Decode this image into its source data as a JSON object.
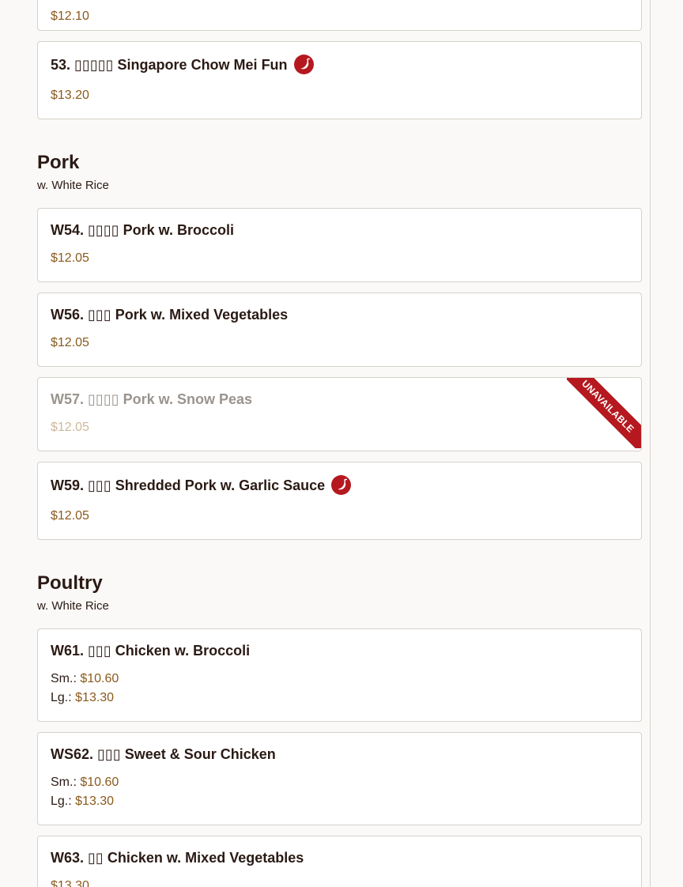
{
  "colors": {
    "price": "#8a5a1c",
    "spicy_badge": "#b5191f",
    "unavailable_ribbon": "#b5191f",
    "border": "#d6d1cb"
  },
  "top_card": {
    "price": "$12.10"
  },
  "card_53": {
    "title": "53. ▯▯▯▯▯ Singapore Chow Mei Fun",
    "spicy_icon": "chili-pepper-icon",
    "price": "$13.20"
  },
  "pork": {
    "title": "Pork",
    "subtitle": "w. White Rice",
    "items": [
      {
        "title": "W54. ▯▯▯▯ Pork w. Broccoli",
        "price": "$12.05"
      },
      {
        "title": "W56. ▯▯▯ Pork w. Mixed Vegetables",
        "price": "$12.05"
      },
      {
        "title": "W57. ▯▯▯▯ Pork w. Snow Peas",
        "price": "$12.05",
        "ribbon": "UNAVAILABLE"
      },
      {
        "title": "W59. ▯▯▯ Shredded Pork w. Garlic Sauce",
        "price": "$12.05",
        "spicy_icon": "chili-pepper-icon"
      }
    ]
  },
  "poultry": {
    "title": "Poultry",
    "subtitle": "w. White Rice",
    "items": [
      {
        "title": "W61. ▯▯▯ Chicken w. Broccoli",
        "sm_label": "Sm.:",
        "sm_price": "$10.60",
        "lg_label": "Lg.:",
        "lg_price": "$13.30"
      },
      {
        "title": "WS62. ▯▯▯ Sweet & Sour Chicken",
        "sm_label": "Sm.:",
        "sm_price": "$10.60",
        "lg_label": "Lg.:",
        "lg_price": "$13.30"
      },
      {
        "title": "W63. ▯▯ Chicken w. Mixed Vegetables",
        "price": "$13.30"
      }
    ]
  }
}
